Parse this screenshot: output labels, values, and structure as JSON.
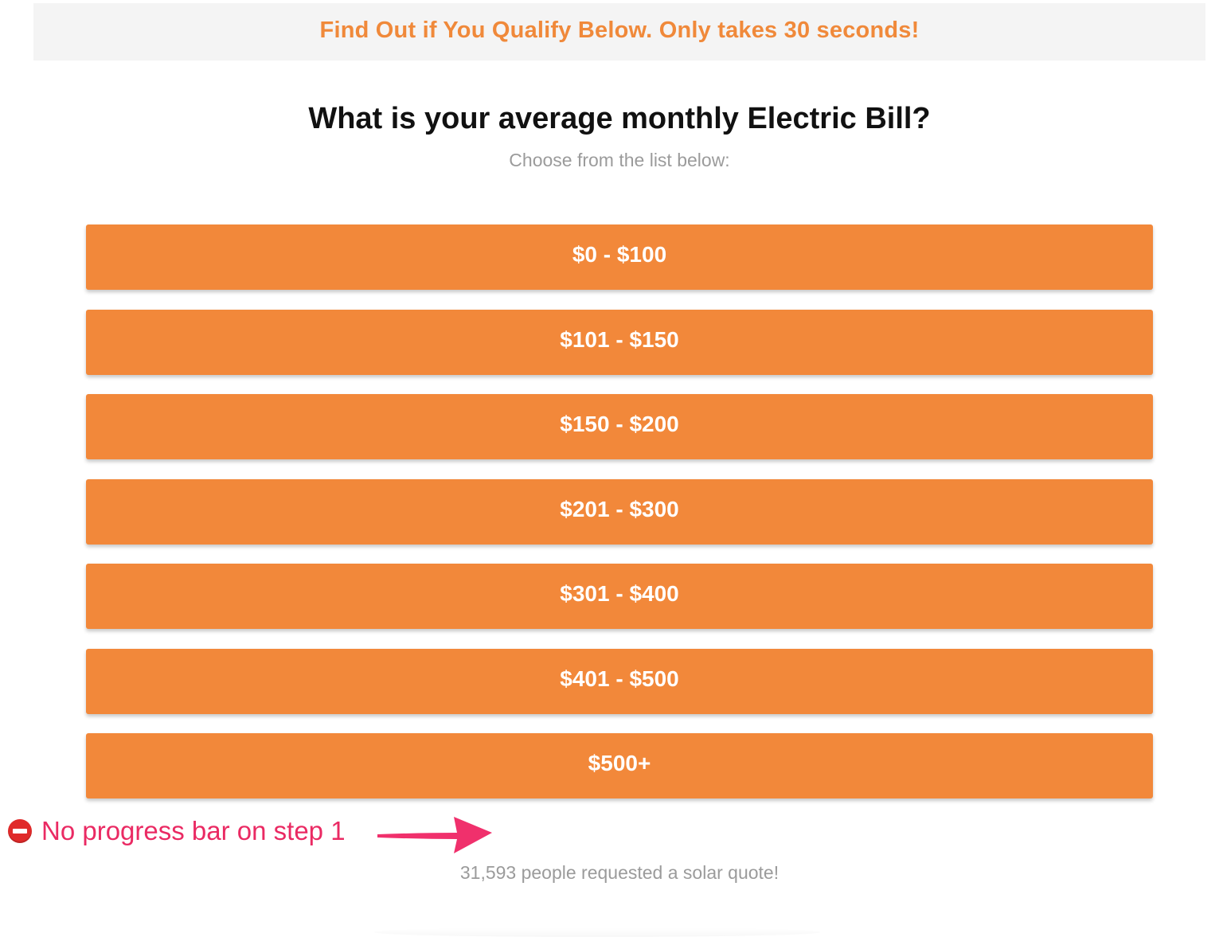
{
  "banner": {
    "text": "Find Out if You Qualify Below. Only takes 30 seconds!"
  },
  "question": {
    "title": "What is your average monthly Electric Bill?",
    "subtitle": "Choose from the list below:"
  },
  "options": [
    {
      "label": "$0 - $100"
    },
    {
      "label": "$101 - $150"
    },
    {
      "label": "$150 - $200"
    },
    {
      "label": "$201 - $300"
    },
    {
      "label": "$301 - $400"
    },
    {
      "label": "$401 - $500"
    },
    {
      "label": "$500+"
    }
  ],
  "annotation": {
    "icon": "no-entry-icon",
    "text": "No progress bar on step 1",
    "color": "#ea2a63"
  },
  "footer": {
    "count_text": "31,593 people requested a solar quote!"
  },
  "colors": {
    "accent": "#f2883a",
    "banner_bg": "#f4f4f4"
  }
}
